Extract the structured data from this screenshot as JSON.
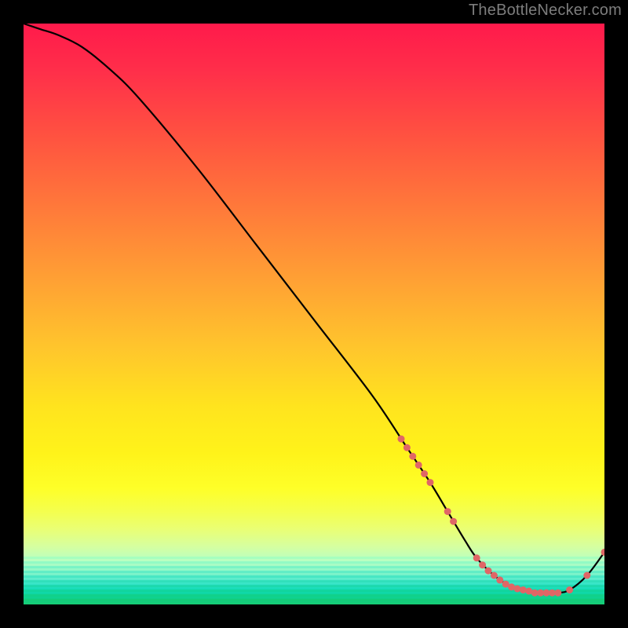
{
  "watermark": "TheBottleNecker.com",
  "chart_data": {
    "type": "line",
    "title": "",
    "xlabel": "",
    "ylabel": "",
    "ylim": [
      0,
      100
    ],
    "xlim": [
      0,
      100
    ],
    "x": [
      0,
      3,
      6,
      10,
      15,
      20,
      30,
      40,
      50,
      60,
      66,
      70,
      73,
      76,
      78,
      81,
      84,
      86,
      88,
      90,
      92,
      94,
      97,
      100
    ],
    "y": [
      100,
      99,
      98,
      96,
      92,
      87,
      75,
      62,
      49,
      36,
      27,
      21,
      16,
      11,
      8,
      5,
      3,
      2.5,
      2,
      2,
      2,
      2.5,
      5,
      9
    ],
    "markers": {
      "comment": "Salmon dots visible on the curve; cluster on the descending segment around x≈66–76 and along the valley/upturn x≈78–100.",
      "x": [
        65,
        66,
        67,
        68,
        69,
        70,
        73,
        74,
        78,
        79,
        80,
        81,
        82,
        83,
        84,
        85,
        86,
        87,
        88,
        89,
        90,
        91,
        92,
        94,
        97,
        100
      ],
      "y": [
        28.5,
        27,
        25.5,
        24,
        22.5,
        21,
        16,
        14.3,
        8,
        6.8,
        5.8,
        5,
        4.2,
        3.5,
        3,
        2.7,
        2.5,
        2.3,
        2,
        2,
        2,
        2,
        2,
        2.5,
        5,
        9
      ]
    },
    "background": {
      "kind": "vertical-gradient",
      "stops": [
        {
          "pct": 0,
          "color": "#ff1a4b"
        },
        {
          "pct": 20,
          "color": "#ff5440"
        },
        {
          "pct": 44,
          "color": "#ffa034"
        },
        {
          "pct": 66,
          "color": "#ffe41e"
        },
        {
          "pct": 84,
          "color": "#eaff74"
        },
        {
          "pct": 92,
          "color": "#b8ffc2"
        },
        {
          "pct": 100,
          "color": "#16cc73"
        }
      ]
    },
    "marker_color": "#e06666",
    "line_color": "#000000"
  }
}
